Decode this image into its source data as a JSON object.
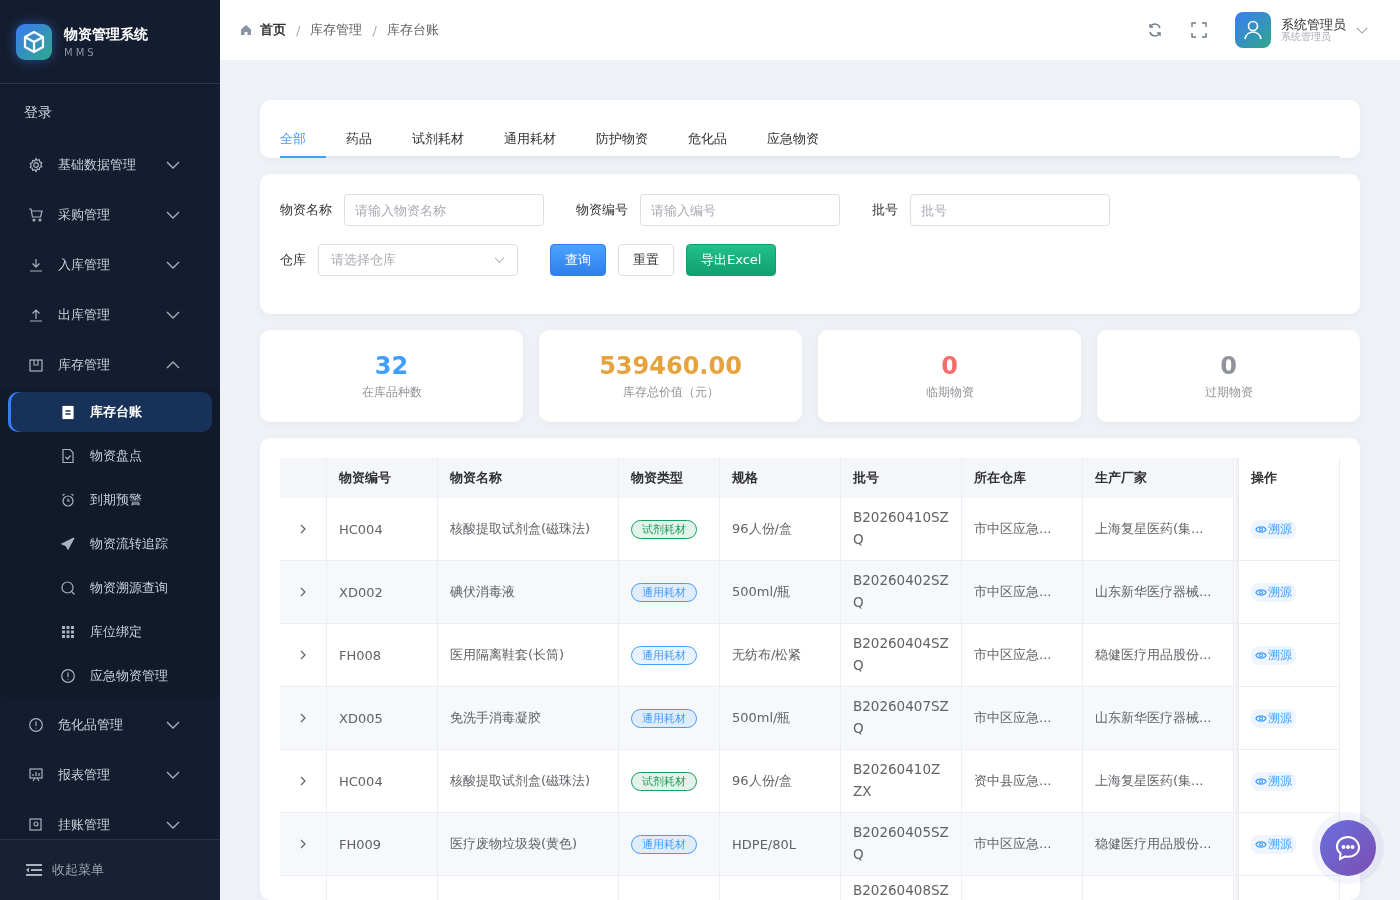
{
  "brand": {
    "title": "物资管理系统",
    "subtitle": "MMS"
  },
  "sidebar": {
    "items": [
      {
        "kind": "link",
        "label": "登录"
      },
      {
        "kind": "group",
        "label": "基础数据管理",
        "expanded": false
      },
      {
        "kind": "group",
        "label": "采购管理",
        "expanded": false
      },
      {
        "kind": "group",
        "label": "入库管理",
        "expanded": false
      },
      {
        "kind": "group",
        "label": "出库管理",
        "expanded": false
      },
      {
        "kind": "group",
        "label": "库存管理",
        "expanded": true,
        "children": [
          {
            "label": "库存台账",
            "selected": true
          },
          {
            "label": "物资盘点",
            "selected": false
          },
          {
            "label": "到期预警",
            "selected": false
          },
          {
            "label": "物资流转追踪",
            "selected": false
          },
          {
            "label": "物资溯源查询",
            "selected": false
          },
          {
            "label": "库位绑定",
            "selected": false
          },
          {
            "label": "应急物资管理",
            "selected": false
          }
        ]
      },
      {
        "kind": "group",
        "label": "危化品管理",
        "expanded": false
      },
      {
        "kind": "group",
        "label": "报表管理",
        "expanded": false
      },
      {
        "kind": "group",
        "label": "挂账管理",
        "expanded": false
      }
    ],
    "collapse_label": "收起菜单"
  },
  "breadcrumb": {
    "separator": "/",
    "items": [
      "首页",
      "库存管理",
      "库存台账"
    ]
  },
  "user": {
    "name": "系统管理员",
    "role": "系统管理员"
  },
  "tabs": [
    {
      "label": "全部",
      "selected": true
    },
    {
      "label": "药品",
      "selected": false
    },
    {
      "label": "试剂耗材",
      "selected": false
    },
    {
      "label": "通用耗材",
      "selected": false
    },
    {
      "label": "防护物资",
      "selected": false
    },
    {
      "label": "危化品",
      "selected": false
    },
    {
      "label": "应急物资",
      "selected": false
    }
  ],
  "filters": [
    {
      "label": "物资名称",
      "placeholder": "请输入物资名称"
    },
    {
      "label": "物资编号",
      "placeholder": "请输入编号"
    },
    {
      "label": "批号",
      "placeholder": "批号"
    }
  ],
  "warehouse": {
    "label": "仓库",
    "placeholder": "请选择仓库"
  },
  "buttons": [
    {
      "kind": "primary",
      "label": "查询"
    },
    {
      "kind": "plain",
      "label": "重置"
    },
    {
      "kind": "success",
      "label": "导出Excel"
    }
  ],
  "stats": [
    {
      "value": "32",
      "label": "在库品种数",
      "color": "#409eff"
    },
    {
      "value": "539460.00",
      "label": "库存总价值（元）",
      "color": "#e6a23c"
    },
    {
      "value": "0",
      "label": "临期物资",
      "color": "#f56c6c"
    },
    {
      "value": "0",
      "label": "过期物资",
      "color": "#909399"
    }
  ],
  "table": {
    "columns": [
      "物资编号",
      "物资名称",
      "物资类型",
      "规格",
      "批号",
      "所在仓库",
      "生产厂家",
      "操作"
    ],
    "rows": [
      {
        "code": "HC004",
        "name": "核酸提取试剂盒(磁珠法)",
        "type": {
          "label": "试剂耗材",
          "color": "#18a058"
        },
        "spec": "96人份/盒",
        "batch": "B20260410SZQ",
        "warehouse": "市中区应急...",
        "maker": "上海复星医药(集...",
        "action": "溯源"
      },
      {
        "code": "XD002",
        "name": "碘伏消毒液",
        "type": {
          "label": "通用耗材",
          "color": "#409eff"
        },
        "spec": "500ml/瓶",
        "batch": "B20260402SZQ",
        "warehouse": "市中区应急...",
        "maker": "山东新华医疗器械...",
        "action": "溯源"
      },
      {
        "code": "FH008",
        "name": "医用隔离鞋套(长筒)",
        "type": {
          "label": "通用耗材",
          "color": "#409eff"
        },
        "spec": "无纺布/松紧",
        "batch": "B20260404SZQ",
        "warehouse": "市中区应急...",
        "maker": "稳健医疗用品股份...",
        "action": "溯源"
      },
      {
        "code": "XD005",
        "name": "免洗手消毒凝胶",
        "type": {
          "label": "通用耗材",
          "color": "#409eff"
        },
        "spec": "500ml/瓶",
        "batch": "B20260407SZQ",
        "warehouse": "市中区应急...",
        "maker": "山东新华医疗器械...",
        "action": "溯源"
      },
      {
        "code": "HC004",
        "name": "核酸提取试剂盒(磁珠法)",
        "type": {
          "label": "试剂耗材",
          "color": "#18a058"
        },
        "spec": "96人份/盒",
        "batch": "B20260410ZZX",
        "warehouse": "资中县应急...",
        "maker": "上海复星医药(集...",
        "action": "溯源"
      },
      {
        "code": "FH009",
        "name": "医疗废物垃圾袋(黄色)",
        "type": {
          "label": "通用耗材",
          "color": "#409eff"
        },
        "spec": "HDPE/80L",
        "batch": "B20260405SZQ",
        "warehouse": "市中区应急...",
        "maker": "稳健医疗用品股份...",
        "action": "溯源"
      },
      {
        "batch": "B20260408SZ"
      }
    ]
  }
}
